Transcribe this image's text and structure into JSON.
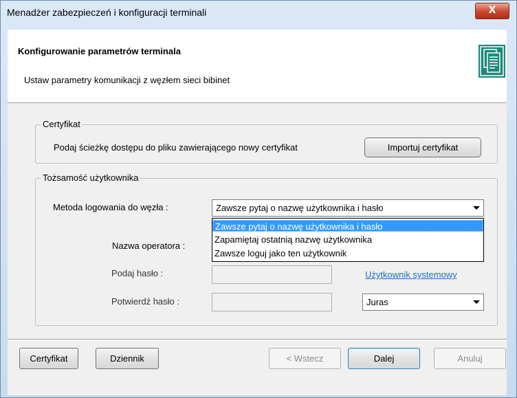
{
  "window": {
    "title": "Menadżer zabezpieczeń i konfiguracji terminali",
    "close_symbol": "X"
  },
  "header": {
    "title": "Konfigurowanie parametrów terminala",
    "subtitle": "Ustaw parametry komunikacji z węzłem sieci bibinet",
    "icon": "document-certificate-icon"
  },
  "certificate_group": {
    "legend": "Certyfikat",
    "description": "Podaj ścieżkę dostępu do pliku zawierającego nowy certyfikat",
    "import_button": "Importuj certyfikat"
  },
  "identity_group": {
    "legend": "Tożsamość użytkownika",
    "method_label": "Metoda  logowania do węzła :",
    "method_selected": "Zawsze pytaj o nazwę użytkownika i hasło",
    "method_options": [
      "Zawsze pytaj o nazwę użytkownika i hasło",
      "Zapamiętaj ostatnią nazwę użytkownika",
      "Zawsze loguj jako ten użytkownik"
    ],
    "operator_label": "Nazwa operatora :",
    "password_label": "Podaj hasło :",
    "confirm_label": "Potwierdź hasło :",
    "system_user_link": "Użytkownik systemowy",
    "user_select_value": "Juras"
  },
  "footer": {
    "certificate_button": "Certyfikat",
    "log_button": "Dziennik",
    "back_button": "< Wstecz",
    "next_button": "Dalej",
    "cancel_button": "Anuluj"
  }
}
